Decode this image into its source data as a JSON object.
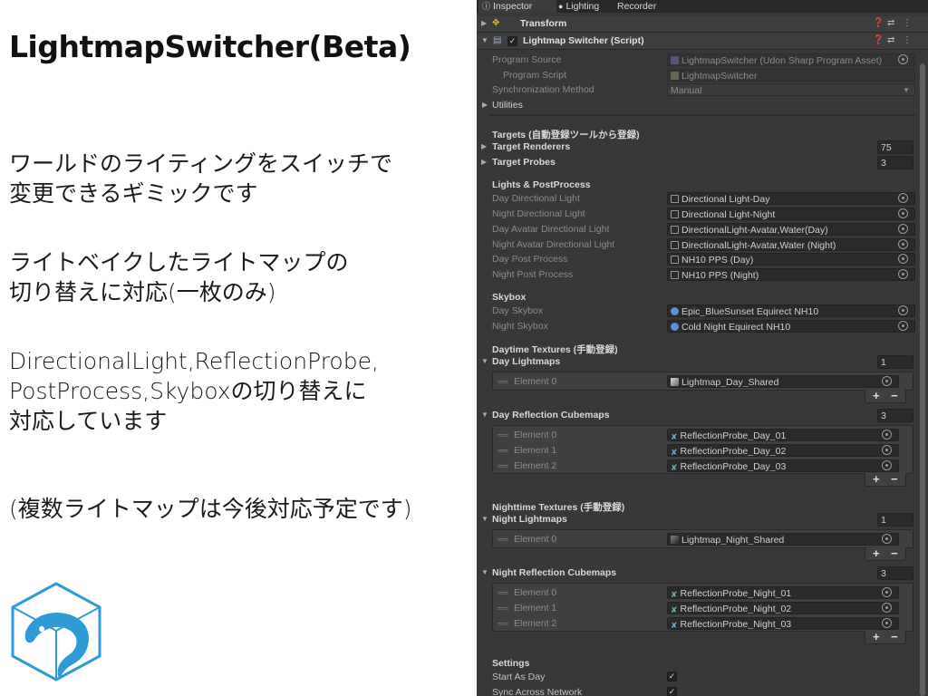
{
  "slide": {
    "title": "LightmapSwitcher(Beta)",
    "p1": [
      "ワールドのライティングをスイッチで",
      "変更できるギミックです"
    ],
    "p2": [
      "ライトベイクしたライトマップの",
      "切り替えに対応(一枚のみ)"
    ],
    "p3": [
      "DirectionalLight,ReflectionProbe,",
      "PostProcess,Skyboxの切り替えに",
      "対応しています"
    ],
    "p4": [
      "(複数ライトマップは今後対応予定です)"
    ]
  },
  "tabs": [
    "Inspector",
    "Lighting",
    "Recorder"
  ],
  "components": {
    "transform": "Transform",
    "script": "Lightmap Switcher (Script)"
  },
  "props": {
    "program_source_label": "Program Source",
    "program_source_value": "LightmapSwitcher (Udon Sharp Program Asset)",
    "program_script_label": "Program Script",
    "program_script_value": "LightmapSwitcher",
    "sync_label": "Synchronization Method",
    "sync_value": "Manual",
    "utilities": "Utilities"
  },
  "targets": {
    "header": "Targets (自動登録ツールから登録)",
    "renderers_label": "Target Renderers",
    "renderers_value": "75",
    "probes_label": "Target Probes",
    "probes_value": "3"
  },
  "lights": {
    "header": "Lights & PostProcess",
    "items": [
      {
        "label": "Day Directional Light",
        "value": "Directional Light-Day"
      },
      {
        "label": "Night Directional Light",
        "value": "Directional Light-Night"
      },
      {
        "label": "Day Avatar Directional Light",
        "value": "DirectionalLight-Avatar,Water(Day)"
      },
      {
        "label": "Night Avatar Directional Light",
        "value": "DirectionalLight-Avatar,Water (Night)"
      },
      {
        "label": "Day Post Process",
        "value": "NH10 PPS (Day)"
      },
      {
        "label": "Night Post Process",
        "value": "NH10 PPS (Night)"
      }
    ]
  },
  "skybox": {
    "header": "Skybox",
    "items": [
      {
        "label": "Day Skybox",
        "value": "Epic_BlueSunset Equirect NH10"
      },
      {
        "label": "Night Skybox",
        "value": "Cold Night Equirect NH10"
      }
    ]
  },
  "daytime": {
    "header": "Daytime Textures (手動登録)",
    "lightmaps_label": "Day Lightmaps",
    "lightmaps_count": "1",
    "lightmaps": [
      {
        "label": "Element 0",
        "value": "Lightmap_Day_Shared"
      }
    ],
    "cubemaps_label": "Day Reflection Cubemaps",
    "cubemaps_count": "3",
    "cubemaps": [
      {
        "label": "Element 0",
        "value": "ReflectionProbe_Day_01"
      },
      {
        "label": "Element 1",
        "value": "ReflectionProbe_Day_02"
      },
      {
        "label": "Element 2",
        "value": "ReflectionProbe_Day_03"
      }
    ]
  },
  "nighttime": {
    "header": "Nighttime Textures (手動登録)",
    "lightmaps_label": "Night Lightmaps",
    "lightmaps_count": "1",
    "lightmaps": [
      {
        "label": "Element 0",
        "value": "Lightmap_Night_Shared"
      }
    ],
    "cubemaps_label": "Night Reflection Cubemaps",
    "cubemaps_count": "3",
    "cubemaps": [
      {
        "label": "Element 0",
        "value": "ReflectionProbe_Night_01"
      },
      {
        "label": "Element 1",
        "value": "ReflectionProbe_Night_02"
      },
      {
        "label": "Element 2",
        "value": "ReflectionProbe_Night_03"
      }
    ]
  },
  "settings": {
    "header": "Settings",
    "start_as_day_label": "Start As Day",
    "start_as_day": true,
    "sync_across_label": "Sync Across Network",
    "sync_across": true
  },
  "buttons": {
    "plus": "+",
    "minus": "−"
  },
  "colors": {
    "inspector_bg": "#383838",
    "logo_blue": "#2f9bd6",
    "text_dark": "#111111"
  }
}
